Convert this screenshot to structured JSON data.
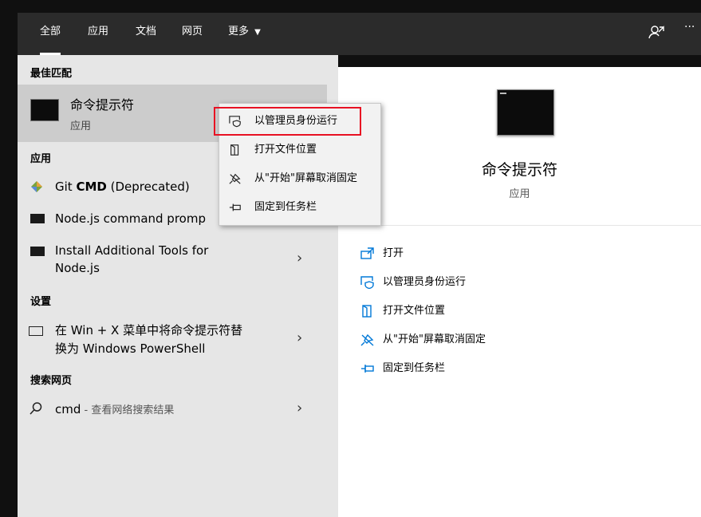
{
  "tabs": [
    {
      "label": "全部",
      "active": true
    },
    {
      "label": "应用"
    },
    {
      "label": "文档"
    },
    {
      "label": "网页"
    },
    {
      "label": "更多"
    }
  ],
  "topbar": {
    "more_caret": "▼",
    "ellipsis": "···"
  },
  "best_match": {
    "heading": "最佳匹配",
    "title": "命令提示符",
    "subtitle": "应用"
  },
  "apps": {
    "heading": "应用",
    "items": [
      {
        "bold_prefix": "Git ",
        "bold": "CMD",
        "rest": " (Deprecated)"
      },
      {
        "label": "Node.js command promp"
      },
      {
        "line1": "Install Additional Tools for",
        "line2": "Node.js"
      }
    ]
  },
  "settings": {
    "heading": "设置",
    "line1": "在 Win + X 菜单中将命令提示符替",
    "line2": "换为 Windows PowerShell"
  },
  "web": {
    "heading": "搜索网页",
    "query": "cmd",
    "suffix": " - 查看网络搜索结果"
  },
  "chevron": "›",
  "context_menu": [
    {
      "label": "以管理员身份运行",
      "icon": "shield-window-icon",
      "highlighted": true
    },
    {
      "label": "打开文件位置",
      "icon": "file-location-icon"
    },
    {
      "label": "从\"开始\"屏幕取消固定",
      "icon": "unpin-icon"
    },
    {
      "label": "固定到任务栏",
      "icon": "pin-taskbar-icon"
    }
  ],
  "detail": {
    "title": "命令提示符",
    "subtitle": "应用",
    "actions": [
      {
        "label": "打开",
        "icon": "open-icon"
      },
      {
        "label": "以管理员身份运行",
        "icon": "shield-window-icon"
      },
      {
        "label": "打开文件位置",
        "icon": "file-location-icon"
      },
      {
        "label": "从\"开始\"屏幕取消固定",
        "icon": "unpin-icon"
      },
      {
        "label": "固定到任务栏",
        "icon": "pin-taskbar-icon"
      }
    ]
  },
  "colors": {
    "accent": "#0078d7",
    "highlight_border": "#e81123"
  }
}
